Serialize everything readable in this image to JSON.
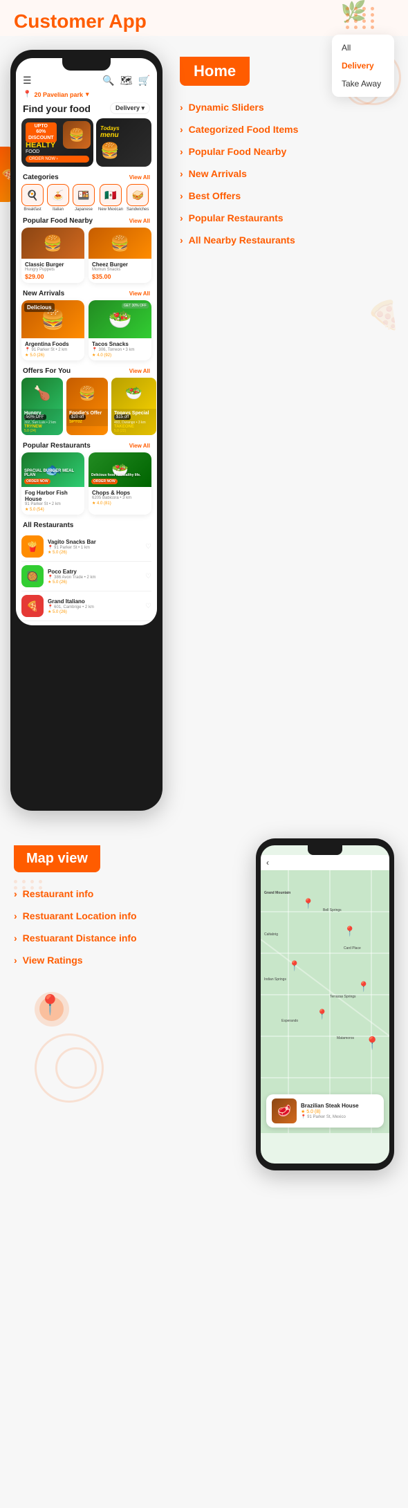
{
  "header": {
    "title": "Customer App",
    "dropdown": {
      "items": [
        "All",
        "Delivery",
        "Take Away"
      ],
      "active": "Delivery"
    }
  },
  "phone": {
    "topbar": {
      "location": "20 Pavelian park",
      "search_icon": "🔍",
      "map_icon": "🗺",
      "cart_icon": "🛒"
    },
    "find_food": {
      "text": "Find your food",
      "delivery_label": "Delivery ▾"
    },
    "banner": {
      "badge": "UPTO\n60%\nDISCOUNT",
      "title": "HEALTY",
      "subtitle": "FOOD",
      "btn": "ORDER NOW ›",
      "secondary_title": "Todays",
      "secondary_sub": "menu"
    },
    "categories": {
      "title": "Categories",
      "view_all": "View All",
      "items": [
        {
          "icon": "🍳",
          "label": "Breakfast"
        },
        {
          "icon": "🍝",
          "label": "Italian"
        },
        {
          "icon": "🍱",
          "label": "Japanese"
        },
        {
          "icon": "🇲🇽",
          "label": "New Mexican"
        },
        {
          "icon": "🥪",
          "label": "Sandwiches"
        }
      ]
    },
    "popular_food": {
      "title": "Popular Food Nearby",
      "view_all": "View All",
      "items": [
        {
          "name": "Classic Burger",
          "shop": "Hungry Puppets",
          "price": "$29.00",
          "icon": "🍔"
        },
        {
          "name": "Cheez Burger",
          "shop": "Momun Snacks",
          "price": "$35.00",
          "icon": "🍔"
        }
      ]
    },
    "new_arrivals": {
      "title": "New Arrivals",
      "view_all": "View All",
      "items": [
        {
          "name": "Argentina Foods",
          "location": "91 Parker St • 2 km",
          "rating": "5.0 (26)",
          "icon": "🍔",
          "badge": ""
        },
        {
          "name": "Tacos Snacks",
          "location": "306, Torreon • 3 km",
          "rating": "4.0 (92)",
          "icon": "🌮",
          "badge": "GET 30% OFF"
        }
      ]
    },
    "offers": {
      "title": "Offers For You",
      "view_all": "View All",
      "items": [
        {
          "name": "Hungry Puppets",
          "location": "302, Sun Luis • 2 km",
          "code": "TRYNEW",
          "rating": "5.0 (24)",
          "badge": "50% OFF",
          "icon": "🍗",
          "color": "green"
        },
        {
          "name": "Foodie's Offer",
          "sub": "App Offer",
          "code": "SPY02",
          "badge": "$20 off",
          "icon": "🍔",
          "color": "orange"
        },
        {
          "name": "Topays Special Menu",
          "location": "493, Durango • 3 km",
          "code": "TAKEONE",
          "rating": "5.0 (22)",
          "badge": "$15 off",
          "icon": "🥗",
          "color": "yellow"
        }
      ]
    },
    "popular_restaurants": {
      "title": "Popular Restaurants",
      "view_all": "View All",
      "items": [
        {
          "name": "Fog Harbor Fish House",
          "location": "91 Parker St • 2 km",
          "rating": "5.0 (54)",
          "overlay": "SPACIAL BURGER MEAL PLAN",
          "icon": "🐟",
          "color": "green"
        },
        {
          "name": "Chops & Hops",
          "location": "6205 Babicora • 3 km",
          "rating": "4.0 (81)",
          "overlay": "Delicious food for healthy life.",
          "icon": "🥗",
          "color": "chops"
        }
      ]
    },
    "all_restaurants": {
      "title": "All Restaurants",
      "items": [
        {
          "name": "Vagito Snacks Bar",
          "location": "91 Parker St • 1 km",
          "rating": "5.0 (26)",
          "icon": "🍟",
          "color": "orange"
        },
        {
          "name": "Poco Eatry",
          "location": "386 Avon Trade • 2 km",
          "rating": "5.0 (26)",
          "icon": "🥘",
          "color": "green"
        },
        {
          "name": "Grand Italiano",
          "location": "601, Cambrige • 2 km",
          "rating": "5.0 (26)",
          "icon": "🍕",
          "color": "red"
        }
      ]
    }
  },
  "home_menu": {
    "title": "Home",
    "items": [
      "Dynamic Sliders",
      "Categorized Food Items",
      "Popular Food Nearby",
      "New Arrivals",
      "Best Offers",
      "Popular Restaurants",
      "All Nearby Restaurants"
    ]
  },
  "map_view": {
    "title": "Map view",
    "menu_items": [
      "Restaurant info",
      "Restuarant Location info",
      "Restuarant Distance info",
      "View Ratings"
    ]
  },
  "map_card": {
    "name": "Brazilian Steak House",
    "rating": "5.0 (8)",
    "location": "91 Parker St, Mexico",
    "icon": "🥩"
  }
}
